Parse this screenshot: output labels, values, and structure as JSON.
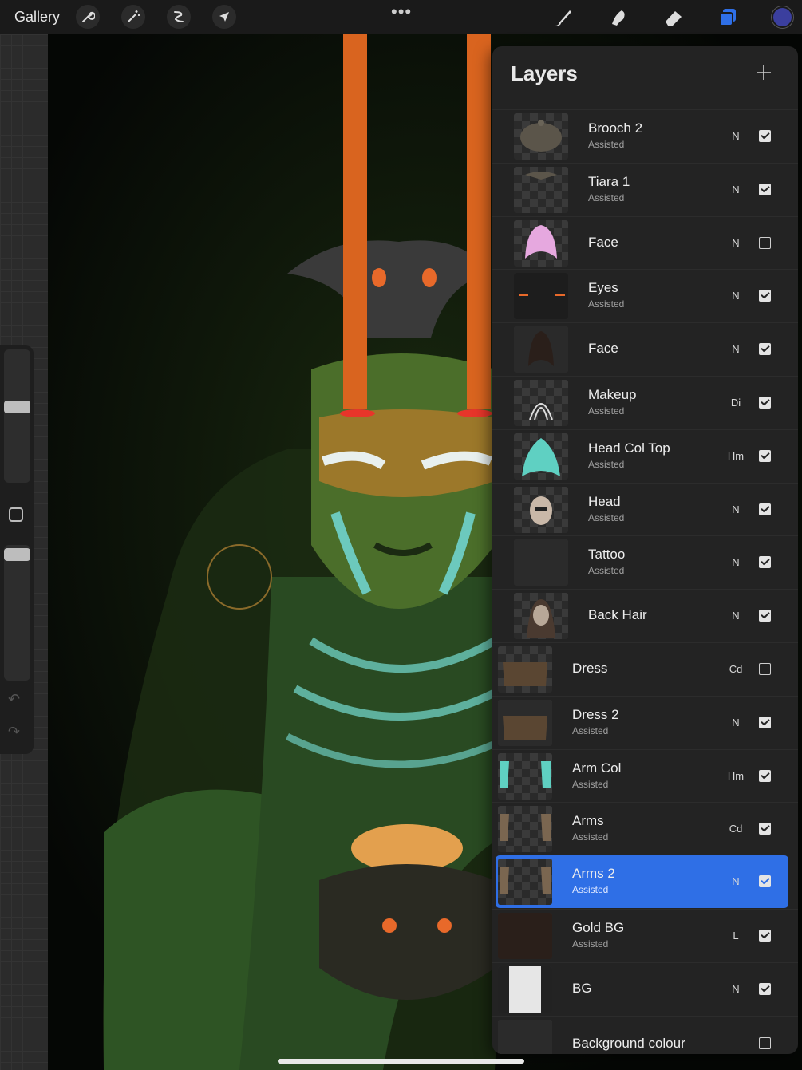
{
  "topbar": {
    "gallery_label": "Gallery",
    "more_label": "•••",
    "color_swatch": "#3b3f9e"
  },
  "panel": {
    "title": "Layers",
    "add_label": "+"
  },
  "layers": [
    {
      "name": "Brooch 2",
      "sub": "Assisted",
      "mode": "N",
      "visible": true
    },
    {
      "name": "Tiara 1",
      "sub": "Assisted",
      "mode": "N",
      "visible": true
    },
    {
      "name": "Face",
      "sub": "",
      "mode": "N",
      "visible": false
    },
    {
      "name": "Eyes",
      "sub": "Assisted",
      "mode": "N",
      "visible": true
    },
    {
      "name": "Face",
      "sub": "",
      "mode": "N",
      "visible": true
    },
    {
      "name": "Makeup",
      "sub": "Assisted",
      "mode": "Di",
      "visible": true
    },
    {
      "name": "Head Col Top",
      "sub": "Assisted",
      "mode": "Hm",
      "visible": true
    },
    {
      "name": "Head",
      "sub": "Assisted",
      "mode": "N",
      "visible": true
    },
    {
      "name": "Tattoo",
      "sub": "Assisted",
      "mode": "N",
      "visible": true
    },
    {
      "name": "Back Hair",
      "sub": "",
      "mode": "N",
      "visible": true
    },
    {
      "name": "Dress",
      "sub": "",
      "mode": "Cd",
      "visible": false
    },
    {
      "name": "Dress 2",
      "sub": "Assisted",
      "mode": "N",
      "visible": true
    },
    {
      "name": "Arm Col",
      "sub": "Assisted",
      "mode": "Hm",
      "visible": true
    },
    {
      "name": "Arms",
      "sub": "Assisted",
      "mode": "Cd",
      "visible": true
    },
    {
      "name": "Arms 2",
      "sub": "Assisted",
      "mode": "N",
      "visible": true,
      "selected": true
    },
    {
      "name": "Gold BG",
      "sub": "Assisted",
      "mode": "L",
      "visible": true
    },
    {
      "name": "BG",
      "sub": "",
      "mode": "N",
      "visible": true
    },
    {
      "name": "Background colour",
      "sub": "",
      "mode": "",
      "visible": false
    }
  ],
  "colors": {
    "accent": "#2f6fe6",
    "orange": "#e8692a",
    "teal": "#5fd0c2",
    "green": "#3f7a34"
  }
}
